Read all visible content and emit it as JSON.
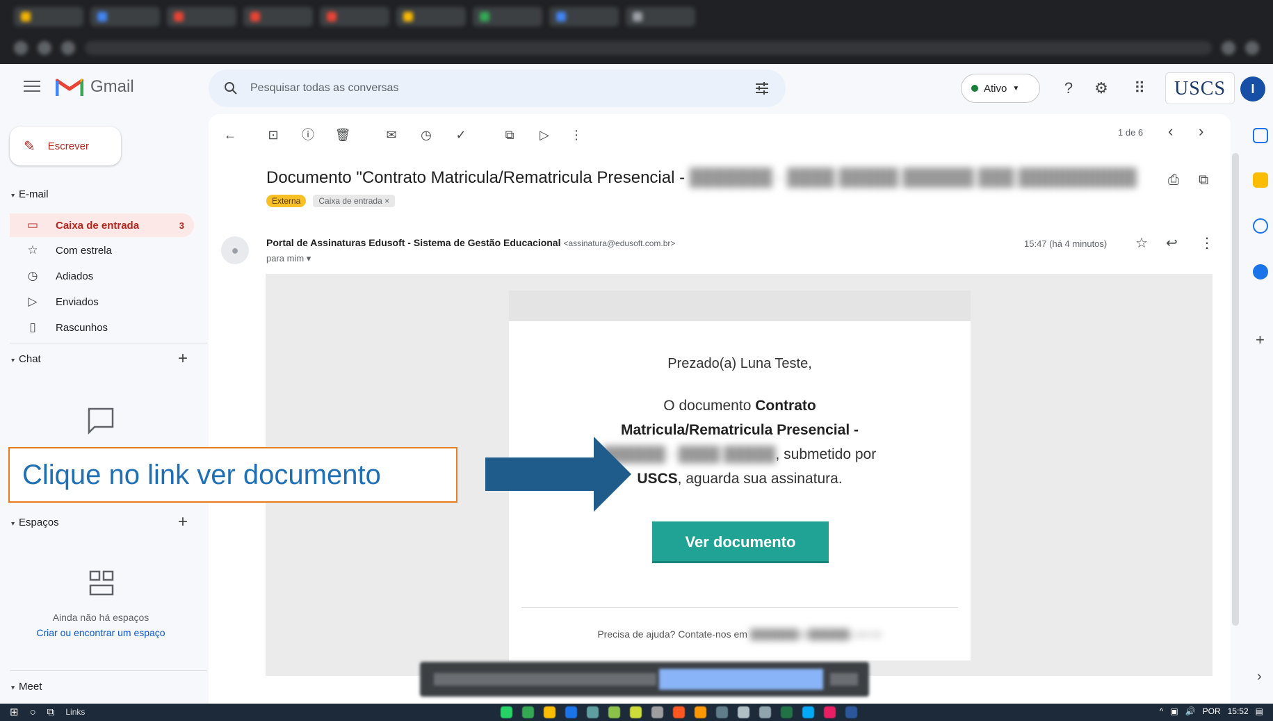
{
  "gmail": {
    "brand": "Gmail",
    "search_placeholder": "Pesquisar todas as conversas",
    "status": "Ativo",
    "org_logo": "USCS",
    "avatar_initial": "I"
  },
  "sidebar": {
    "compose_label": "Escrever",
    "email_section": "E-mail",
    "items": [
      {
        "label": "Caixa de entrada",
        "count": "3",
        "icon": "inbox-icon"
      },
      {
        "label": "Com estrela",
        "icon": "star-icon"
      },
      {
        "label": "Adiados",
        "icon": "clock-icon"
      },
      {
        "label": "Enviados",
        "icon": "send-icon"
      },
      {
        "label": "Rascunhos",
        "icon": "draft-icon"
      }
    ],
    "chat_section": "Chat",
    "spaces_section": "Espaços",
    "spaces_empty": "Ainda não há espaços",
    "spaces_link": "Criar ou encontrar um espaço",
    "meet_section": "Meet"
  },
  "toolbar": {
    "pager": "1 de 6"
  },
  "message": {
    "subject": "Documento \"Contrato Matricula/Rematricula Presencial - ",
    "labels": [
      "Externa",
      "Caixa de entrada ×"
    ],
    "sender_name": "Portal de Assinaturas Edusoft - Sistema de Gestão Educacional",
    "sender_email": "<assinatura@edusoft.com.br>",
    "to_me": "para mim ▾",
    "time": "15:47 (há 4 minutos)"
  },
  "email_body": {
    "greeting": "Prezado(a) Luna Teste,",
    "line_prefix": "O documento ",
    "doc_name": "Contrato Matricula/Rematricula Presencial -",
    "submitted_by": ", submetido por",
    "sender_org": "USCS",
    "suffix": ", aguarda sua assinatura.",
    "cta": "Ver documento",
    "help": "Precisa de ajuda? Contate-nos em"
  },
  "annotation": {
    "text": "Clique no link ver documento",
    "box_color": "#e57c1d",
    "arrow_color": "#1f5c8c"
  },
  "taskbar": {
    "links": "Links",
    "lang": "POR",
    "clock": "15:52"
  }
}
